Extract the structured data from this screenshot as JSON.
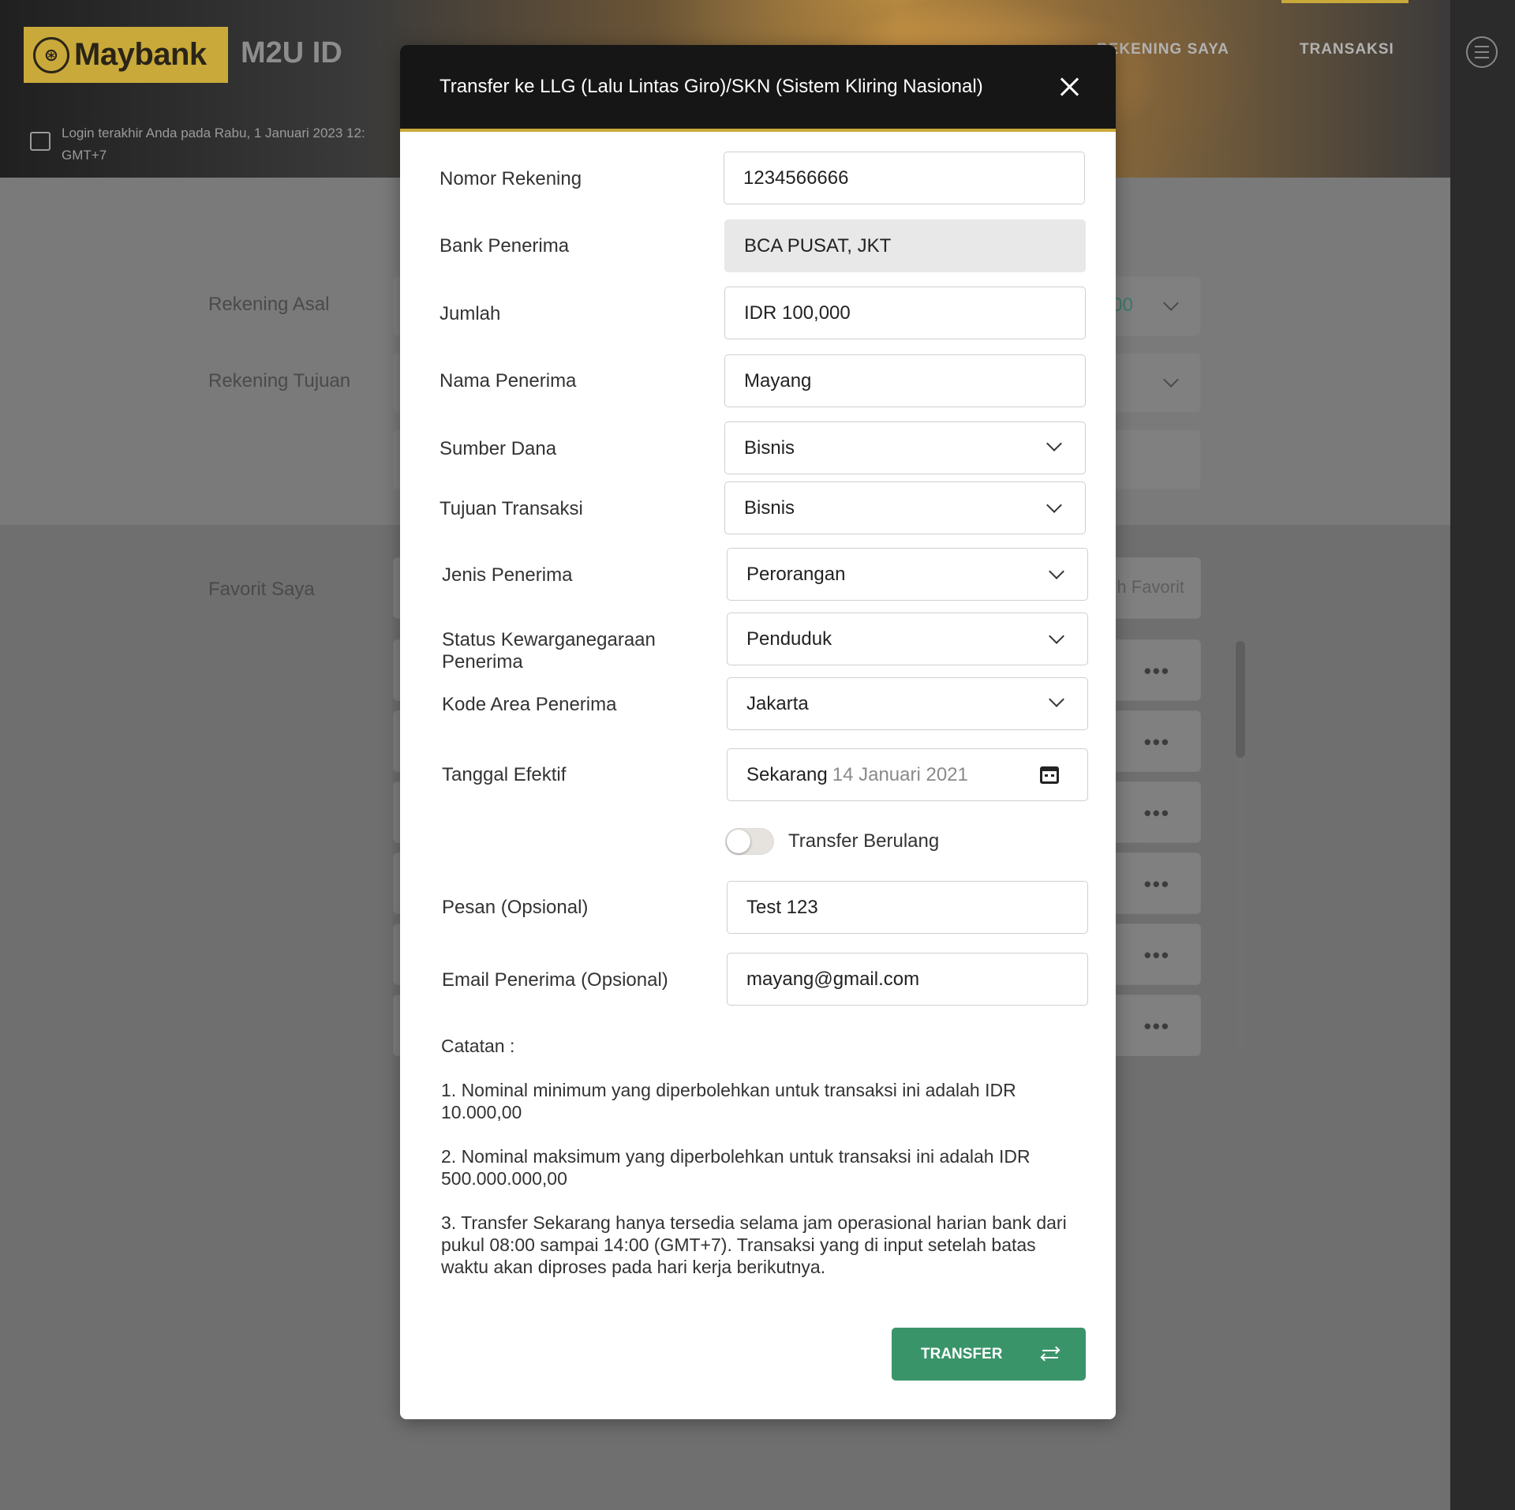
{
  "header": {
    "logo_text": "Maybank",
    "app_name": "M2U ID",
    "last_login_line1": "Login terakhir Anda pada Rabu, 1 Januari 2023 12:",
    "last_login_line2": "GMT+7",
    "nav": [
      "REKENING SAYA",
      "TRANSAKSI"
    ]
  },
  "background_form": {
    "rekening_asal_label": "Rekening Asal",
    "rekening_asal_value_fragment": "00",
    "rekening_tujuan_label": "Rekening Tujuan",
    "favorit_label": "Favorit Saya",
    "favorit_search_fragment": "h Favorit",
    "dots": "•••"
  },
  "modal": {
    "title": "Transfer ke LLG (Lalu Lintas Giro)/SKN (Sistem Kliring Nasional)",
    "fields": {
      "nomor_rekening": {
        "label": "Nomor Rekening",
        "value": "1234566666"
      },
      "bank_penerima": {
        "label": "Bank Penerima",
        "value": "BCA PUSAT, JKT"
      },
      "jumlah": {
        "label": "Jumlah",
        "value": "IDR 100,000"
      },
      "nama_penerima": {
        "label": "Nama Penerima",
        "value": "Mayang"
      },
      "sumber_dana": {
        "label": "Sumber Dana",
        "value": "Bisnis"
      },
      "tujuan_transaksi": {
        "label": "Tujuan Transaksi",
        "value": "Bisnis"
      },
      "jenis_penerima": {
        "label": "Jenis Penerima",
        "value": "Perorangan"
      },
      "status_kewarganegaraan": {
        "label_line1": "Status Kewarganegaraan",
        "label_line2": "Penerima",
        "value": "Penduduk"
      },
      "kode_area": {
        "label": "Kode Area Penerima",
        "value": "Jakarta"
      },
      "tanggal_efektif": {
        "label": "Tanggal Efektif",
        "value": "Sekarang",
        "date": "14 Januari 2021"
      },
      "transfer_berulang": {
        "label": "Transfer Berulang",
        "enabled": false
      },
      "pesan": {
        "label": "Pesan (Opsional)",
        "value": "Test 123"
      },
      "email": {
        "label": "Email Penerima (Opsional)",
        "value": "mayang@gmail.com"
      }
    },
    "notes": {
      "title": "Catatan :",
      "items": [
        "1. Nominal minimum yang diperbolehkan untuk transaksi ini adalah IDR 10.000,00",
        "2. Nominal maksimum yang diperbolehkan untuk transaksi ini adalah IDR 500.000.000,00",
        "3. Transfer Sekarang hanya tersedia selama jam operasional harian bank dari pukul 08:00 sampai 14:00 (GMT+7). Transaksi yang di input setelah batas waktu akan diproses pada hari kerja berikutnya."
      ]
    },
    "transfer_button": "TRANSFER"
  },
  "colors": {
    "brand_gold": "#c9a93a",
    "primary_green": "#3a946a",
    "header_dark": "#161616"
  }
}
